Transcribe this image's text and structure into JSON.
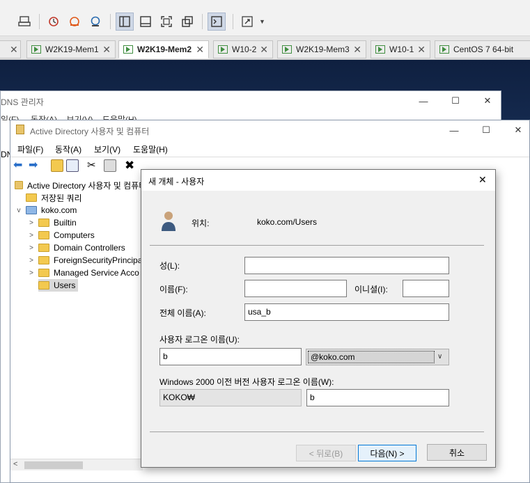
{
  "vm_tabs": [
    {
      "label": "W2K19-Mem1",
      "active": false
    },
    {
      "label": "W2K19-Mem2",
      "active": true
    },
    {
      "label": "W10-2",
      "active": false
    },
    {
      "label": "W2K19-Mem3",
      "active": false
    },
    {
      "label": "W10-1",
      "active": false
    },
    {
      "label": "CentOS 7 64-bit",
      "active": false
    }
  ],
  "tab_close_glyph": "✕",
  "dns_window": {
    "title": "DNS 관리자",
    "menu_partial": [
      "일(F)",
      "동작(A)",
      "보기(V)",
      "도움말(H)"
    ],
    "left_fragment": "DN"
  },
  "aduc_window": {
    "title": "Active Directory 사용자 및 컴퓨터",
    "menu": [
      "파일(F)",
      "동작(A)",
      "보기(V)",
      "도움말(H)"
    ],
    "tree": [
      {
        "label": "Active Directory 사용자 및 컴퓨터",
        "level": 0,
        "expander": ""
      },
      {
        "label": "저장된 쿼리",
        "level": 1,
        "expander": ""
      },
      {
        "label": "koko.com",
        "level": 1,
        "expander": "v"
      },
      {
        "label": "Builtin",
        "level": 2,
        "expander": ">"
      },
      {
        "label": "Computers",
        "level": 2,
        "expander": ">"
      },
      {
        "label": "Domain Controllers",
        "level": 2,
        "expander": ">"
      },
      {
        "label": "ForeignSecurityPrincipa",
        "level": 2,
        "expander": ">"
      },
      {
        "label": "Managed Service Acco",
        "level": 2,
        "expander": ">"
      },
      {
        "label": "Users",
        "level": 2,
        "expander": "",
        "selected": true
      }
    ]
  },
  "dialog": {
    "title": "새 개체 - 사용자",
    "location_label": "위치:",
    "location_value": "koko.com/Users",
    "last_name_label": "성(L):",
    "last_name_value": "",
    "first_name_label": "이름(F):",
    "first_name_value": "",
    "initials_label": "이니셜(I):",
    "initials_value": "",
    "full_name_label": "전체 이름(A):",
    "full_name_value": "usa_b",
    "logon_name_label": "사용자 로그온 이름(U):",
    "logon_name_value": "b",
    "upn_suffix": "@koko.com",
    "pre2000_label": "Windows 2000 이전 버전 사용자 로그온 이름(W):",
    "pre2000_domain": "KOKO₩",
    "pre2000_name": "b",
    "back_button": "< 뒤로(B)",
    "next_button": "다음(N) >",
    "cancel_button": "취소"
  }
}
